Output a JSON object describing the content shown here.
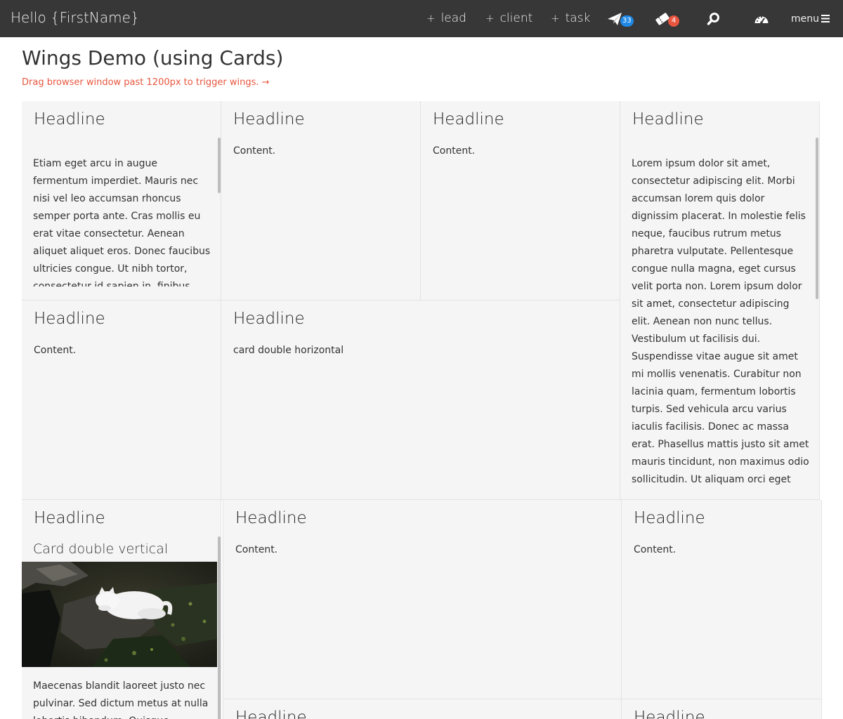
{
  "header": {
    "greeting": "Hello {FirstName}",
    "quick_actions": [
      {
        "plus": "+",
        "label": "lead"
      },
      {
        "plus": "+",
        "label": "client"
      },
      {
        "plus": "+",
        "label": "task"
      }
    ],
    "messages_count": "33",
    "tickets_count": "4",
    "menu_label": "menu"
  },
  "page": {
    "title": "Wings Demo (using Cards)",
    "hint": "Drag browser window past 1200px to trigger wings. →"
  },
  "cards": [
    {
      "headline": "Headline",
      "body": "Etiam eget arcu in augue fermentum imperdiet. Mauris nec nisi vel leo accumsan rhoncus semper porta ante. Cras mollis eu erat vitae consectetur. Aenean aliquet aliquet eros. Donec faucibus ultricies congue. Ut nibh tortor, consectetur id sapien in, finibus congue sapien. Etiam ullamcorper mi id"
    },
    {
      "headline": "Headline",
      "content": "Content."
    },
    {
      "headline": "Headline",
      "content": "Content."
    },
    {
      "headline": "Headline",
      "body": "Lorem ipsum dolor sit amet, consectetur adipiscing elit. Morbi accumsan lorem quis dolor dignissim placerat. In molestie felis neque, faucibus rutrum metus pharetra vulputate. Pellentesque congue nulla magna, eget cursus velit porta non. Lorem ipsum dolor sit amet, consectetur adipiscing elit. Aenean non nunc tellus. Vestibulum ut facilisis dui. Suspendisse vitae augue sit amet mi mollis venenatis. Curabitur non lacinia quam, fermentum lobortis turpis. Sed vehicula arcu varius iaculis facilisis. Donec ac massa erat. Phasellus mattis justo sit amet mauris tincidunt, non maximus odio sollicitudin. Ut aliquam orci eget tincidunt maximus."
    },
    {
      "headline": "Headline",
      "content": "Content."
    },
    {
      "headline": "Headline",
      "content": "card double horizontal"
    },
    {
      "headline": "Headline",
      "subheadline": "Card double vertical",
      "body": "Maecenas blandit laoreet justo nec pulvinar. Sed dictum metus at nulla lobortis bibendum. Quisque dapibus"
    },
    {
      "headline": "Headline",
      "content": "Content."
    },
    {
      "headline": "Headline",
      "content": "Content."
    },
    {
      "headline": "Headline"
    },
    {
      "headline": "Headline"
    }
  ],
  "colors": {
    "topbar": "#373737",
    "accent_red": "#e8563f",
    "badge_blue": "#1e88e5",
    "card_bg": "#f5f5f5"
  }
}
